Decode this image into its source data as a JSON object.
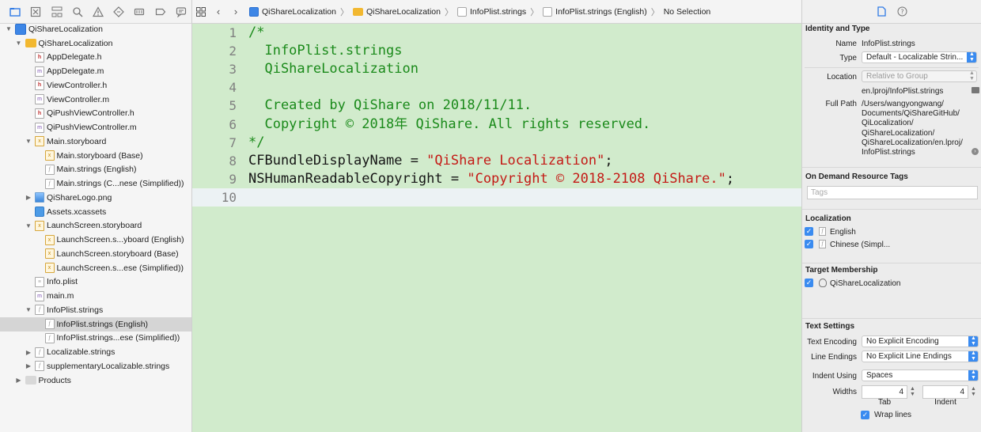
{
  "navigator": {
    "toolbar_icons": [
      "folder-icon",
      "source-control-icon",
      "hierarchy-icon",
      "search-icon",
      "warning-icon",
      "test-icon",
      "debug-icon",
      "breakpoint-icon",
      "report-icon"
    ],
    "items": [
      {
        "label": "QiShareLocalization",
        "depth": 0,
        "disclosure": "open",
        "icon": "project"
      },
      {
        "label": "QiShareLocalization",
        "depth": 1,
        "disclosure": "open",
        "icon": "folder"
      },
      {
        "label": "AppDelegate.h",
        "depth": 2,
        "icon": "h"
      },
      {
        "label": "AppDelegate.m",
        "depth": 2,
        "icon": "m"
      },
      {
        "label": "ViewController.h",
        "depth": 2,
        "icon": "h"
      },
      {
        "label": "ViewController.m",
        "depth": 2,
        "icon": "m"
      },
      {
        "label": "QiPushViewController.h",
        "depth": 2,
        "icon": "h"
      },
      {
        "label": "QiPushViewController.m",
        "depth": 2,
        "icon": "m"
      },
      {
        "label": "Main.storyboard",
        "depth": 2,
        "disclosure": "open",
        "icon": "storyboard"
      },
      {
        "label": "Main.storyboard (Base)",
        "depth": 3,
        "icon": "storyboard"
      },
      {
        "label": "Main.strings (English)",
        "depth": 3,
        "icon": "strings"
      },
      {
        "label": "Main.strings (C...nese (Simplified))",
        "depth": 3,
        "icon": "strings"
      },
      {
        "label": "QiShareLogo.png",
        "depth": 2,
        "disclosure": "closed",
        "icon": "png"
      },
      {
        "label": "Assets.xcassets",
        "depth": 2,
        "icon": "assets"
      },
      {
        "label": "LaunchScreen.storyboard",
        "depth": 2,
        "disclosure": "open",
        "icon": "storyboard"
      },
      {
        "label": "LaunchScreen.s...yboard (English)",
        "depth": 3,
        "icon": "storyboard"
      },
      {
        "label": "LaunchScreen.storyboard (Base)",
        "depth": 3,
        "icon": "storyboard"
      },
      {
        "label": "LaunchScreen.s...ese (Simplified))",
        "depth": 3,
        "icon": "storyboard"
      },
      {
        "label": "Info.plist",
        "depth": 2,
        "icon": "plist"
      },
      {
        "label": "main.m",
        "depth": 2,
        "icon": "m"
      },
      {
        "label": "InfoPlist.strings",
        "depth": 2,
        "disclosure": "open",
        "icon": "strings"
      },
      {
        "label": "InfoPlist.strings (English)",
        "depth": 3,
        "icon": "strings",
        "selected": true
      },
      {
        "label": "InfoPlist.strings...ese (Simplified))",
        "depth": 3,
        "icon": "strings"
      },
      {
        "label": "Localizable.strings",
        "depth": 2,
        "disclosure": "closed",
        "icon": "strings"
      },
      {
        "label": "supplementaryLocalizable.strings",
        "depth": 2,
        "disclosure": "closed",
        "icon": "strings"
      },
      {
        "label": "Products",
        "depth": 1,
        "disclosure": "closed",
        "icon": "folder-gray"
      }
    ]
  },
  "jumpbar": {
    "crumbs": [
      {
        "label": "QiShareLocalization",
        "icon": "proj"
      },
      {
        "label": "QiShareLocalization",
        "icon": "folder"
      },
      {
        "label": "InfoPlist.strings",
        "icon": "file"
      },
      {
        "label": "InfoPlist.strings (English)",
        "icon": "file"
      },
      {
        "label": "No Selection",
        "icon": ""
      }
    ]
  },
  "editor": {
    "current_line": 10,
    "lines": [
      {
        "n": "1",
        "parts": [
          {
            "t": "/*",
            "c": "comment"
          }
        ]
      },
      {
        "n": "2",
        "parts": [
          {
            "t": "  InfoPlist.strings",
            "c": "comment"
          }
        ]
      },
      {
        "n": "3",
        "parts": [
          {
            "t": "  QiShareLocalization",
            "c": "comment"
          }
        ]
      },
      {
        "n": "4",
        "parts": []
      },
      {
        "n": "5",
        "parts": [
          {
            "t": "  Created by QiShare on 2018/11/11.",
            "c": "comment"
          }
        ]
      },
      {
        "n": "6",
        "parts": [
          {
            "t": "  Copyright © 2018年 QiShare. All rights reserved.",
            "c": "comment"
          }
        ]
      },
      {
        "n": "7",
        "parts": [
          {
            "t": "*/",
            "c": "comment"
          }
        ]
      },
      {
        "n": "8",
        "parts": [
          {
            "t": "CFBundleDisplayName = ",
            "c": ""
          },
          {
            "t": "\"QiShare Localization\"",
            "c": "str"
          },
          {
            "t": ";",
            "c": ""
          }
        ]
      },
      {
        "n": "9",
        "parts": [
          {
            "t": "NSHumanReadableCopyright = ",
            "c": ""
          },
          {
            "t": "\"Copyright © 2018-2108 QiShare.\"",
            "c": "str"
          },
          {
            "t": ";",
            "c": ""
          }
        ]
      },
      {
        "n": "10",
        "parts": []
      }
    ]
  },
  "inspector": {
    "identity": {
      "title": "Identity and Type",
      "name_label": "Name",
      "name_value": "InfoPlist.strings",
      "type_label": "Type",
      "type_value": "Default - Localizable Strin...",
      "location_label": "Location",
      "location_value": "Relative to Group",
      "location_path": "en.lproj/InfoPlist.strings",
      "fullpath_label": "Full Path",
      "fullpath_lines": [
        "/Users/wangyongwang/",
        "Documents/QiShareGitHub/",
        "QiLocalization/",
        "QiShareLocalization/",
        "QiShareLocalization/en.lproj/",
        "InfoPlist.strings"
      ]
    },
    "on_demand": {
      "title": "On Demand Resource Tags",
      "placeholder": "Tags"
    },
    "localization": {
      "title": "Localization",
      "items": [
        "English",
        "Chinese (Simpl..."
      ]
    },
    "target": {
      "title": "Target Membership",
      "items": [
        "QiShareLocalization"
      ]
    },
    "text_settings": {
      "title": "Text Settings",
      "encoding_label": "Text Encoding",
      "encoding_value": "No Explicit Encoding",
      "endings_label": "Line Endings",
      "endings_value": "No Explicit Line Endings",
      "indent_label": "Indent Using",
      "indent_value": "Spaces",
      "widths_label": "Widths",
      "tab_value": "4",
      "tab_label": "Tab",
      "indent_width_value": "4",
      "indent_width_label": "Indent",
      "wrap_label": "Wrap lines"
    }
  },
  "colors": {
    "editor_bg": "#d1ebcc",
    "comment": "#1a8a1a",
    "string": "#c41a16",
    "accent": "#3a8bf0"
  }
}
